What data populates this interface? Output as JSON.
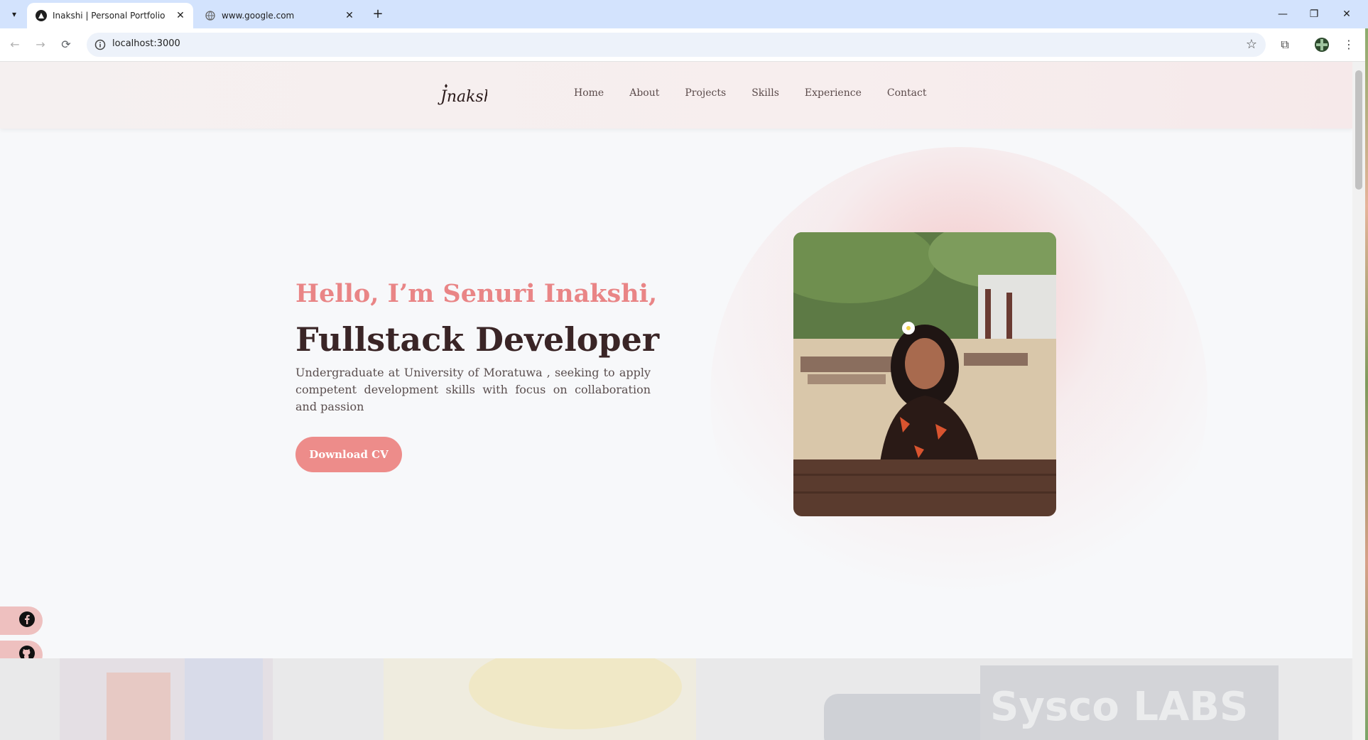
{
  "browser": {
    "tabs": [
      {
        "title": "Inakshi | Personal Portfolio",
        "active": true,
        "icon": "react-icon"
      },
      {
        "title": "www.google.com",
        "active": false,
        "icon": "globe-icon"
      }
    ],
    "url": "localhost:3000"
  },
  "site": {
    "logo_text": "Jnakshi",
    "nav": [
      "Home",
      "About",
      "Projects",
      "Skills",
      "Experience",
      "Contact"
    ]
  },
  "hero": {
    "greeting": "Hello, I’m Senuri Inakshi,",
    "title": "Fullstack Developer",
    "description": "Undergraduate at University of Moratuwa , seeking to apply competent development skills with focus on collaboration and passion",
    "cv_button": "Download CV"
  },
  "social_links": [
    "facebook-icon",
    "github-icon",
    "instagram-icon",
    "linkedin-icon"
  ],
  "bottom_band": {
    "watermark_text": "Sysco LABS"
  },
  "colors": {
    "accent": "#ed8c8a",
    "heading": "#3a2526",
    "greeting": "#e98586",
    "social_bg": "#eec0bf"
  }
}
